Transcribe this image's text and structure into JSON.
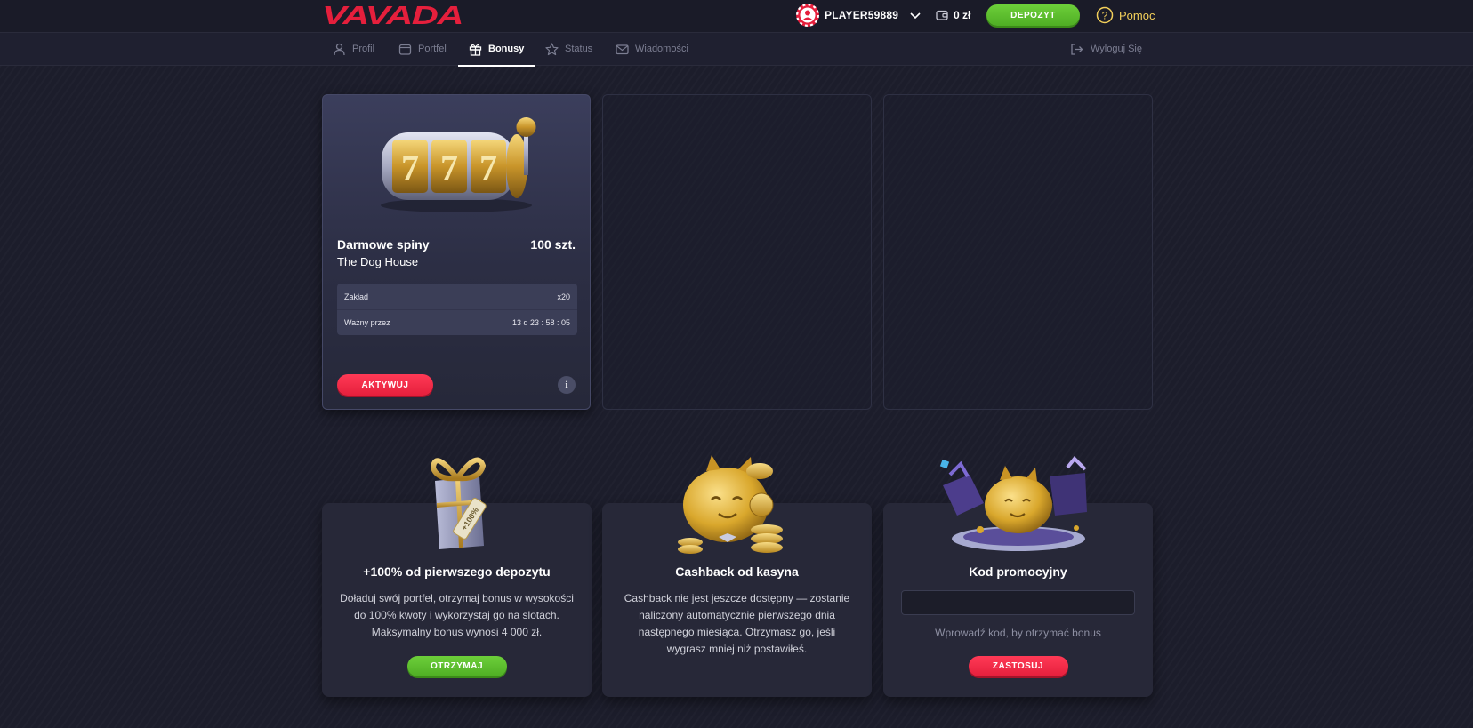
{
  "header": {
    "logo_text": "VAVADA",
    "player_name": "PLAYER59889",
    "balance": "0 zł",
    "deposit_label": "DEPOZYT",
    "help_label": "Pomoc"
  },
  "nav": {
    "tabs": [
      {
        "label": "Profil",
        "icon": "user-icon"
      },
      {
        "label": "Portfel",
        "icon": "wallet-icon"
      },
      {
        "label": "Bonusy",
        "icon": "gift-icon",
        "active": true
      },
      {
        "label": "Status",
        "icon": "star-icon"
      },
      {
        "label": "Wiadomości",
        "icon": "mail-icon"
      }
    ],
    "logout_label": "Wyloguj Się"
  },
  "bonus_card": {
    "title": "Darmowe spiny",
    "amount": "100 szt.",
    "game": "The Dog House",
    "rows": [
      {
        "label": "Zakład",
        "value": "x20"
      },
      {
        "label": "Ważny przez",
        "value": "13 d 23 : 58 : 05"
      }
    ],
    "activate_label": "AKTYWUJ",
    "info_label": "i"
  },
  "promos": [
    {
      "title": "+100% od pierwszego depozytu",
      "description": "Doładuj swój portfel, otrzymaj bonus w wysokości do 100% kwoty i wykorzystaj go na slotach. Maksymalny bonus wynosi 4 000 zł.",
      "button_label": "OTRZYMAJ",
      "art_label": "+100%"
    },
    {
      "title": "Cashback od kasyna",
      "description": "Cashback nie jest jeszcze dostępny — zostanie naliczony automatycznie pierwszego dnia następnego miesiąca. Otrzymasz go, jeśli wygrasz mniej niż postawiłeś."
    },
    {
      "title": "Kod promocyjny",
      "input_value": "",
      "hint": "Wprowadź kod, by otrzymać bonus",
      "button_label": "ZASTOSUJ"
    }
  ],
  "colors": {
    "background": "#1c1d2b",
    "brand_red": "#e51f3c",
    "accent_green": "#4fae24",
    "help_yellow": "#f2cf5a",
    "gold": "#d9a72c"
  }
}
